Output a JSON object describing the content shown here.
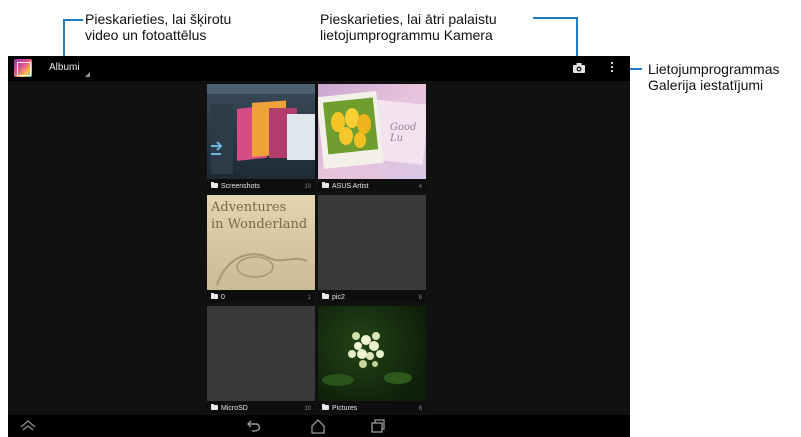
{
  "callouts": {
    "albums": {
      "line1": "Pieskarieties, lai šķirotu",
      "line2": "video un fotoattēlus"
    },
    "camera": {
      "line1": "Pieskarieties, lai ātri palaistu",
      "line2": "lietojumprogrammu Kamera"
    },
    "settings": {
      "line1": "Lietojumprogrammas",
      "line2": "Galerija iestatījumi"
    }
  },
  "action_bar": {
    "title": "Albumi",
    "icons": [
      "gallery-app-icon",
      "camera-icon",
      "overflow-menu-icon"
    ]
  },
  "albums": [
    {
      "name": "Screenshots",
      "count": "10"
    },
    {
      "name": "ASUS Artist",
      "count": "4"
    },
    {
      "name": "0",
      "count": "1"
    },
    {
      "name": "pic2",
      "count": "8"
    },
    {
      "name": "MicroSD",
      "count": "10"
    },
    {
      "name": "Pictures",
      "count": "8"
    }
  ],
  "thumb_text": {
    "wonderland_1": "Adventures",
    "wonderland_2": "in Wonderland",
    "good_luck": "Good Lu"
  },
  "navbar": {
    "icons": [
      "up-icon",
      "back-icon",
      "home-icon",
      "recent-apps-icon"
    ]
  },
  "colors": {
    "callout_line": "#1e7bc4",
    "action_bar": "#000000",
    "screen_bg": "#111111"
  }
}
